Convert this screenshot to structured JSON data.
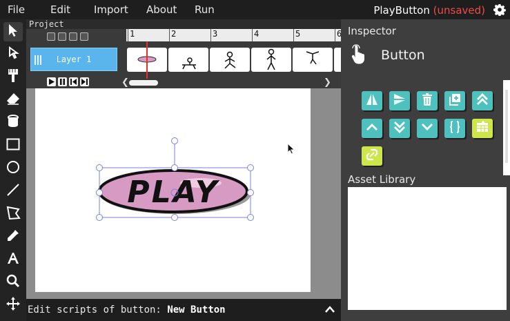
{
  "menu": {
    "items": [
      "File",
      "Edit",
      "Import",
      "About",
      "Run"
    ]
  },
  "title": {
    "name": "PlayButton",
    "status": "(unsaved)"
  },
  "icons": {
    "settings": "gear-icon",
    "tools": [
      "cursor-icon",
      "path-cursor-icon",
      "brush-icon",
      "eraser-icon",
      "fill-bucket-icon",
      "rectangle-icon",
      "ellipse-icon",
      "line-icon",
      "polygon-icon",
      "eyedropper-icon",
      "text-icon",
      "zoom-icon",
      "pan-icon"
    ]
  },
  "timeline": {
    "project_label": "Project",
    "layer_name": "Layer 1",
    "frame_numbers": [
      "1",
      "2",
      "3",
      "4",
      "5",
      "6"
    ]
  },
  "stage": {
    "button_text": "PLAY"
  },
  "status": {
    "prefix": "Edit scripts of button:",
    "object_name": "New Button"
  },
  "inspector": {
    "title": "Inspector",
    "object_type": "Button",
    "actions": [
      "flip-horizontal-icon",
      "flip-vertical-icon",
      "delete-icon",
      "duplicate-icon",
      "send-to-front-icon",
      "move-forward-icon",
      "send-to-back-icon",
      "move-backward-icon",
      "edit-scripts-icon",
      "break-apart-icon",
      "convert-icon"
    ]
  },
  "asset_library": {
    "title": "Asset Library"
  },
  "colors": {
    "accent_teal": "#4ec0be",
    "accent_lime": "#cde64c",
    "layer_blue": "#5ab5ec",
    "playhead_red": "#e0312c",
    "unsaved_red": "#f14a4a",
    "button_pink": "#d79ac3"
  }
}
